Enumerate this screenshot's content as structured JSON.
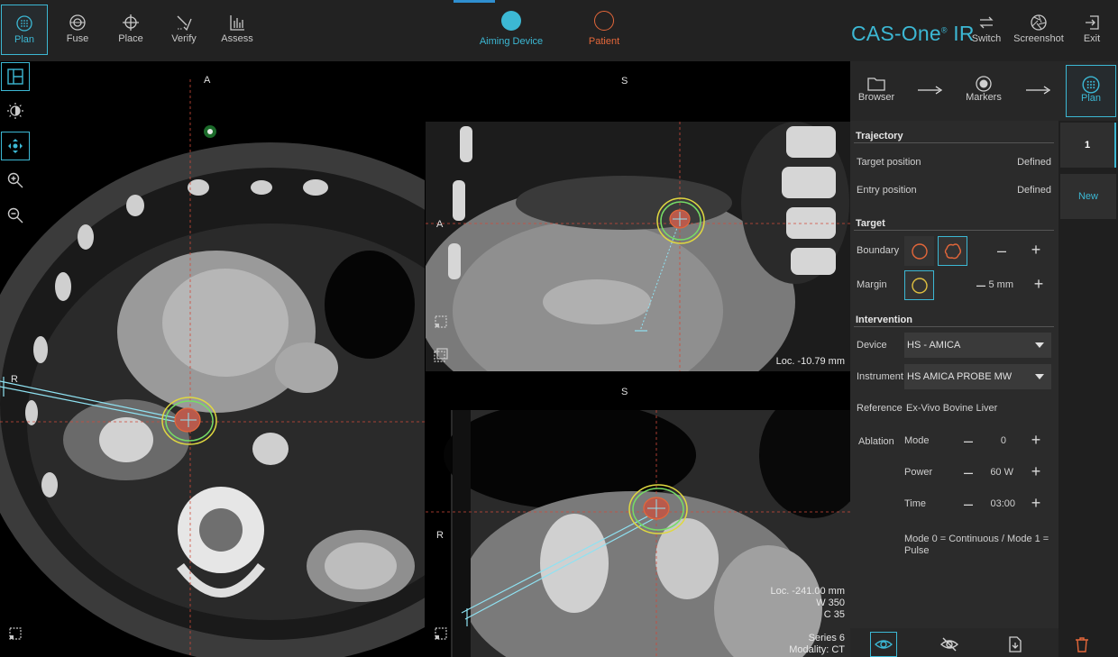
{
  "app": {
    "brand": "CAS-One",
    "brand_reg": "®",
    "brand_suffix": " IR"
  },
  "workflow": [
    {
      "label": "Plan",
      "icon": "plan-target-icon",
      "active": true
    },
    {
      "label": "Fuse",
      "icon": "fuse-icon",
      "active": false
    },
    {
      "label": "Place",
      "icon": "crosshair-icon",
      "active": false
    },
    {
      "label": "Verify",
      "icon": "verify-icon",
      "active": false
    },
    {
      "label": "Assess",
      "icon": "assess-chart-icon",
      "active": false
    }
  ],
  "devices": {
    "aiming": {
      "label": "Aiming Device",
      "color": "#3cb8d4"
    },
    "patient": {
      "label": "Patient",
      "color": "#e4673a"
    }
  },
  "top_right": {
    "switch": "Switch",
    "screenshot": "Screenshot",
    "exit": "Exit"
  },
  "viewports": {
    "axial": {
      "top": "A",
      "left": "R"
    },
    "sagittal": {
      "top": "S",
      "left": "A",
      "loc": "Loc. -10.79 mm"
    },
    "coronal": {
      "top": "S",
      "left": "R",
      "loc": "Loc. -241.00 mm",
      "w": "W 350",
      "c": "C 35",
      "series": "Series 6",
      "modality": "Modality: CT"
    }
  },
  "steps": {
    "browser": "Browser",
    "markers": "Markers",
    "plan": "Plan"
  },
  "trajectory": {
    "title": "Trajectory",
    "target_label": "Target position",
    "target_value": "Defined",
    "entry_label": "Entry position",
    "entry_value": "Defined"
  },
  "target": {
    "title": "Target",
    "boundary_label": "Boundary",
    "margin_label": "Margin",
    "margin_value": "5 mm"
  },
  "intervention": {
    "title": "Intervention",
    "device_label": "Device",
    "device_value": "HS - AMICA",
    "instrument_label": "Instrument",
    "instrument_value": "HS AMICA PROBE MW",
    "reference_label": "Reference",
    "reference_value": "Ex-Vivo Bovine Liver",
    "ablation_label": "Ablation",
    "mode_label": "Mode",
    "mode_value": "0",
    "power_label": "Power",
    "power_value": "60 W",
    "time_label": "Time",
    "time_value": "03:00",
    "note": "Mode 0 = Continuous / Mode 1 = Pulse"
  },
  "plans": {
    "selected": "1",
    "new": "New"
  },
  "colors": {
    "accent": "#3cb8d4",
    "patient": "#e4673a",
    "target_margin": "#e0c040"
  }
}
